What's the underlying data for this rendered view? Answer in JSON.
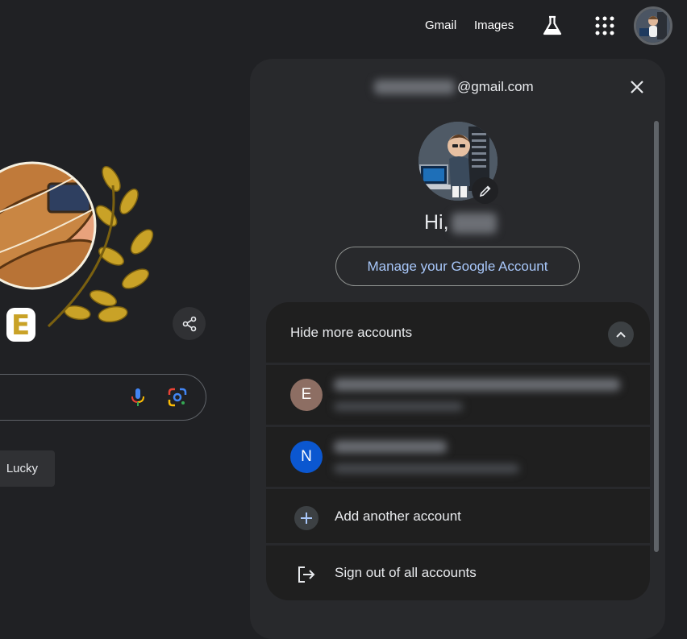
{
  "topbar": {
    "gmail_label": "Gmail",
    "images_label": "Images",
    "labs_icon": "flask-icon",
    "apps_icon": "apps-grid-icon",
    "avatar_icon": "profile-avatar"
  },
  "doodle": {
    "letter": "E",
    "share_icon": "share-icon"
  },
  "search": {
    "mic_icon": "mic-icon",
    "lens_icon": "google-lens-icon",
    "lucky_label": "Lucky"
  },
  "account_panel": {
    "email_suffix": "@gmail.com",
    "greeting": "Hi,",
    "manage_label": "Manage your Google Account",
    "hide_accounts_label": "Hide more accounts",
    "accounts": [
      {
        "initial": "E",
        "color": "#8d6e63"
      },
      {
        "initial": "N",
        "color": "#0b57d0"
      }
    ],
    "add_account_label": "Add another account",
    "sign_out_label": "Sign out of all accounts"
  },
  "colors": {
    "background": "#202124",
    "panel": "#28292c",
    "accent_link": "#a8c7fa"
  }
}
